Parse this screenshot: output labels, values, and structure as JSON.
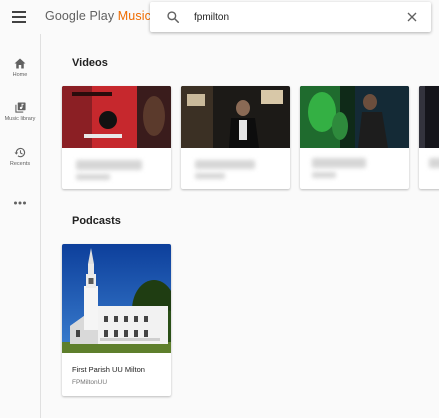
{
  "app": {
    "brand_prefix": "Google Play ",
    "brand_accent": "Music",
    "accent_color": "#ef6c00"
  },
  "search": {
    "query": "fpmilton",
    "icon": "search-icon",
    "clear_icon": "close-icon"
  },
  "sidebar": {
    "items": [
      {
        "label": "Home",
        "icon": "home-icon"
      },
      {
        "label": "Music library",
        "icon": "music-library-icon"
      },
      {
        "label": "Recents",
        "icon": "history-icon"
      }
    ],
    "more_icon": "more-horizontal-icon"
  },
  "sections": {
    "videos": {
      "title": "Videos",
      "cards": [
        {
          "thumb": "video-thumbnail"
        },
        {
          "thumb": "video-thumbnail"
        },
        {
          "thumb": "video-thumbnail"
        },
        {
          "thumb": "video-thumbnail"
        }
      ]
    },
    "podcasts": {
      "title": "Podcasts",
      "cards": [
        {
          "title": "First Parish UU Milton",
          "subtitle": "FPMiltonUU"
        }
      ]
    }
  }
}
